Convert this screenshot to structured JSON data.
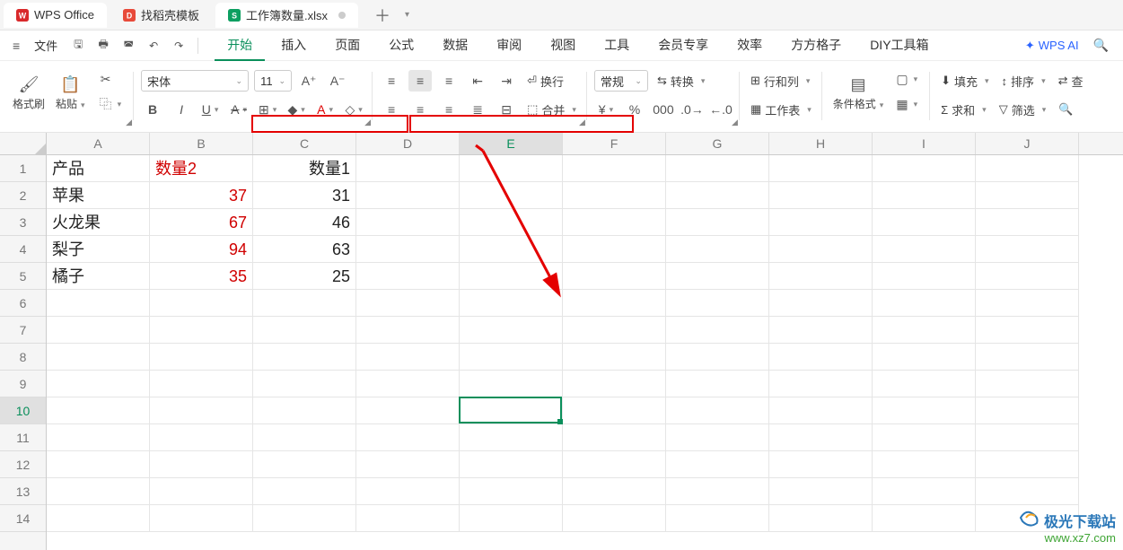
{
  "tabs": {
    "app": "WPS Office",
    "template": "找稻壳模板",
    "workbook": "工作簿数量.xlsx"
  },
  "quickaccess": {
    "file": "文件"
  },
  "menu": {
    "start": "开始",
    "insert": "插入",
    "page": "页面",
    "formula": "公式",
    "data": "数据",
    "review": "审阅",
    "view": "视图",
    "tools": "工具",
    "member": "会员专享",
    "efficiency": "效率",
    "square": "方方格子",
    "diy": "DIY工具箱"
  },
  "ai": {
    "label": "WPS AI"
  },
  "ribbon": {
    "format_brush": "格式刷",
    "paste": "粘贴",
    "font_name": "宋体",
    "font_size": "11",
    "wrap": "换行",
    "merge": "合并",
    "number_format": "常规",
    "convert": "转换",
    "rowcol": "行和列",
    "worksheet": "工作表",
    "cond_format": "条件格式",
    "fill": "填充",
    "sum": "求和",
    "sort": "排序",
    "filter": "筛选",
    "find": "查"
  },
  "columns": [
    "A",
    "B",
    "C",
    "D",
    "E",
    "F",
    "G",
    "H",
    "I",
    "J"
  ],
  "rows": [
    "1",
    "2",
    "3",
    "4",
    "5",
    "6",
    "7",
    "8",
    "9",
    "10",
    "11",
    "12",
    "13",
    "14"
  ],
  "selected": {
    "col_index": 4,
    "row_index": 9
  },
  "chart_data": {
    "type": "table",
    "headers": {
      "A1": "产品",
      "B1": "数量2",
      "C1": "数量1"
    },
    "rows": [
      {
        "product": "苹果",
        "qty2": 37,
        "qty1": 31
      },
      {
        "product": "火龙果",
        "qty2": 67,
        "qty1": 46
      },
      {
        "product": "梨子",
        "qty2": 94,
        "qty1": 63
      },
      {
        "product": "橘子",
        "qty2": 35,
        "qty1": 25
      }
    ]
  },
  "watermark": {
    "line1": "极光下载站",
    "line2": "www.xz7.com"
  }
}
